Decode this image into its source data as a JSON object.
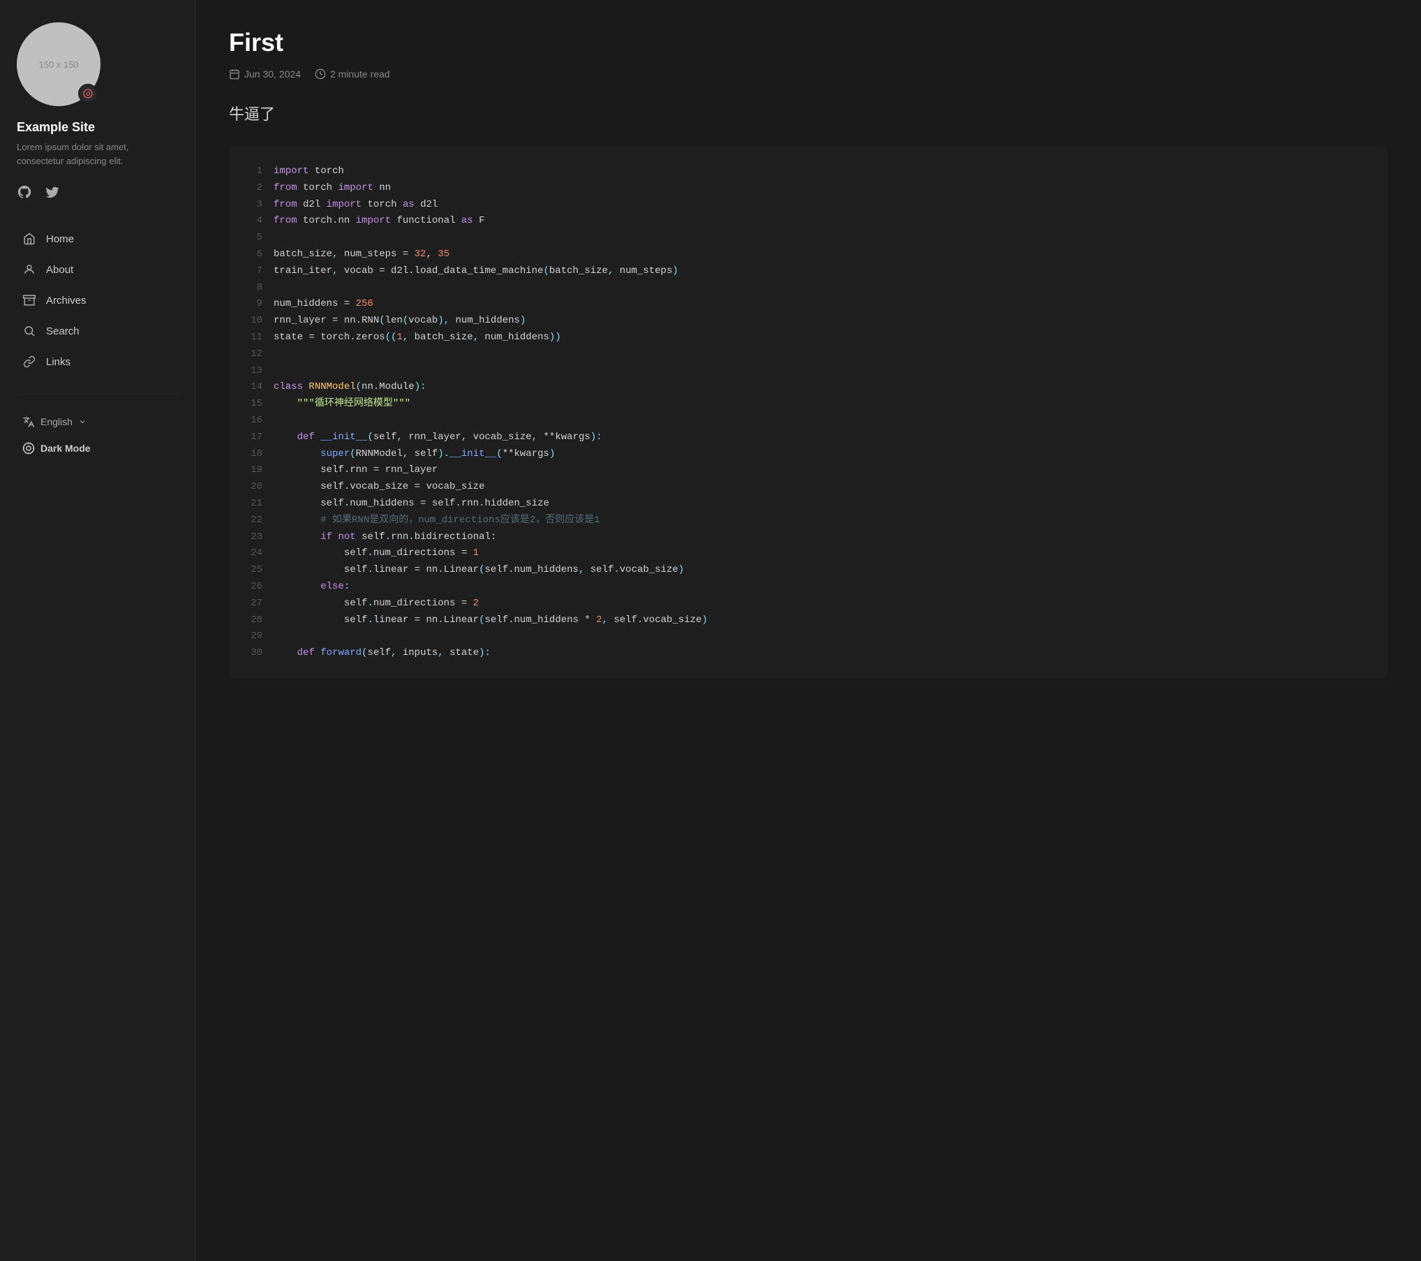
{
  "sidebar": {
    "avatar_label": "150 x 150",
    "site_title": "Example Site",
    "site_desc": "Lorem ipsum dolor sit amet, consectetur adipiscing elit.",
    "nav_items": [
      {
        "id": "home",
        "label": "Home",
        "icon": "home"
      },
      {
        "id": "about",
        "label": "About",
        "icon": "person"
      },
      {
        "id": "archives",
        "label": "Archives",
        "icon": "archive"
      },
      {
        "id": "search",
        "label": "Search",
        "icon": "search"
      },
      {
        "id": "links",
        "label": "Links",
        "icon": "link"
      }
    ],
    "language_label": "English",
    "dark_mode_label": "Dark Mode"
  },
  "post": {
    "title": "First",
    "date": "Jun 30, 2024",
    "read_time": "2 minute read",
    "excerpt": "牛逼了"
  },
  "code": {
    "lines": [
      {
        "num": 1,
        "raw": "import torch"
      },
      {
        "num": 2,
        "raw": "from torch import nn"
      },
      {
        "num": 3,
        "raw": "from d2l import torch as d2l"
      },
      {
        "num": 4,
        "raw": "from torch.nn import functional as F"
      },
      {
        "num": 5,
        "raw": ""
      },
      {
        "num": 6,
        "raw": "batch_size, num_steps = 32, 35"
      },
      {
        "num": 7,
        "raw": "train_iter, vocab = d2l.load_data_time_machine(batch_size, num_steps)"
      },
      {
        "num": 8,
        "raw": ""
      },
      {
        "num": 9,
        "raw": "num_hiddens = 256"
      },
      {
        "num": 10,
        "raw": "rnn_layer = nn.RNN(len(vocab), num_hiddens)"
      },
      {
        "num": 11,
        "raw": "state = torch.zeros((1, batch_size, num_hiddens))"
      },
      {
        "num": 12,
        "raw": ""
      },
      {
        "num": 13,
        "raw": ""
      },
      {
        "num": 14,
        "raw": "class RNNModel(nn.Module):"
      },
      {
        "num": 15,
        "raw": "    \"\"\"循环神经网络模型\"\"\""
      },
      {
        "num": 16,
        "raw": ""
      },
      {
        "num": 17,
        "raw": "    def __init__(self, rnn_layer, vocab_size, **kwargs):"
      },
      {
        "num": 18,
        "raw": "        super(RNNModel, self).__init__(**kwargs)"
      },
      {
        "num": 19,
        "raw": "        self.rnn = rnn_layer"
      },
      {
        "num": 20,
        "raw": "        self.vocab_size = vocab_size"
      },
      {
        "num": 21,
        "raw": "        self.num_hiddens = self.rnn.hidden_size"
      },
      {
        "num": 22,
        "raw": "        # 如果RNN是双向的，num_directions应该是2，否则应该是1"
      },
      {
        "num": 23,
        "raw": "        if not self.rnn.bidirectional:"
      },
      {
        "num": 24,
        "raw": "            self.num_directions = 1"
      },
      {
        "num": 25,
        "raw": "            self.linear = nn.Linear(self.num_hiddens, self.vocab_size)"
      },
      {
        "num": 26,
        "raw": "        else:"
      },
      {
        "num": 27,
        "raw": "            self.num_directions = 2"
      },
      {
        "num": 28,
        "raw": "            self.linear = nn.Linear(self.num_hiddens * 2, self.vocab_size)"
      },
      {
        "num": 29,
        "raw": ""
      },
      {
        "num": 30,
        "raw": "    def forward(self, inputs, state):"
      }
    ]
  }
}
